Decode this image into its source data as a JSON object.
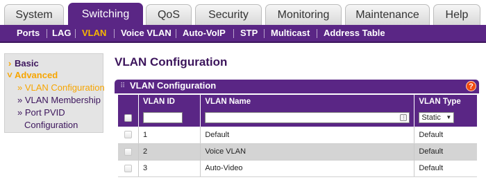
{
  "top_tabs": [
    {
      "label": "System",
      "active": false
    },
    {
      "label": "Switching",
      "active": true
    },
    {
      "label": "QoS",
      "active": false
    },
    {
      "label": "Security",
      "active": false
    },
    {
      "label": "Monitoring",
      "active": false
    },
    {
      "label": "Maintenance",
      "active": false
    },
    {
      "label": "Help",
      "active": false
    }
  ],
  "sub_nav": [
    {
      "label": "Ports",
      "active": false
    },
    {
      "label": "LAG",
      "active": false
    },
    {
      "label": "VLAN",
      "active": true
    },
    {
      "label": "Voice VLAN",
      "active": false
    },
    {
      "label": "Auto-VoIP",
      "active": false
    },
    {
      "label": "STP",
      "active": false
    },
    {
      "label": "Multicast",
      "active": false
    },
    {
      "label": "Address Table",
      "active": false
    }
  ],
  "left_nav": {
    "basic": "Basic",
    "advanced": "Advanced",
    "items": [
      {
        "label": "» VLAN Configuration",
        "active": true
      },
      {
        "label": "» VLAN Membership",
        "active": false
      },
      {
        "label": "» Port PVID",
        "active": false
      },
      {
        "label": "Configuration",
        "active": false
      }
    ]
  },
  "page_title": "VLAN Configuration",
  "panel": {
    "title": "VLAN Configuration",
    "help_glyph": "?"
  },
  "table": {
    "headers": [
      "",
      "VLAN ID",
      "VLAN Name",
      "VLAN Type"
    ],
    "input_row": {
      "vlan_id": "",
      "vlan_name": "",
      "vlan_type": "Static"
    },
    "rows": [
      {
        "id": "1",
        "name": "Default",
        "type": "Default"
      },
      {
        "id": "2",
        "name": "Voice VLAN",
        "type": "Default"
      },
      {
        "id": "3",
        "name": "Auto-Video",
        "type": "Default"
      }
    ]
  },
  "colors": {
    "brand_purple": "#5a2685",
    "accent_orange": "#f7a500",
    "help_red": "#f04a10"
  },
  "icons": {
    "grip": "grip-icon",
    "help": "help-icon",
    "key": "key-icon",
    "chevron": "chevron-right-icon"
  }
}
